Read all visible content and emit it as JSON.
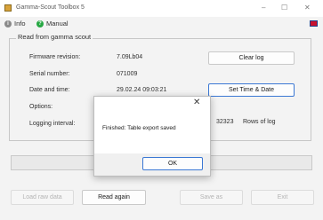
{
  "window": {
    "title": "Gamma-Scout Toolbox 5",
    "controls": [
      "–",
      "☐",
      "✕"
    ]
  },
  "menu": {
    "info": "Info",
    "manual": "Manual"
  },
  "group": {
    "title": "Read from gamma scout",
    "fields": [
      {
        "label": "Firmware revision:",
        "value": "7.09Lb04"
      },
      {
        "label": "Serial number:",
        "value": "071009"
      },
      {
        "label": "Date and time:",
        "value": "29.02.24 09:03:21"
      },
      {
        "label": "Options:",
        "value": ""
      },
      {
        "label": "Logging interval:",
        "value": ""
      }
    ],
    "clear_log": "Clear log",
    "set_time_date": "Set Time & Date",
    "rows_count": "32323",
    "rows_label": "Rows of log"
  },
  "status": {
    "text": "d"
  },
  "bottom_buttons": {
    "load_raw": "Load raw data",
    "read_again": "Read again",
    "save_as": "Save as",
    "exit": "Exit"
  },
  "dialog": {
    "close": "✕",
    "message": "Finished: Table export saved",
    "ok": "OK"
  },
  "colors": {
    "window_bg": "#f3f3f3",
    "accent": "#3b78d4",
    "help_icon": "#27a844"
  }
}
